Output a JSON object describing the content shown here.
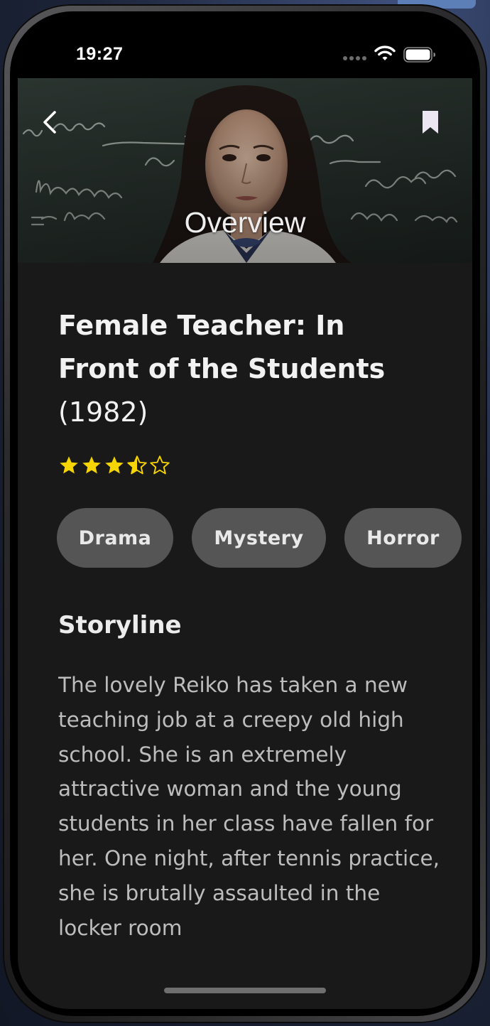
{
  "status_bar": {
    "time": "19:27"
  },
  "header": {
    "title": "Overview",
    "back_icon": "chevron-left-icon",
    "bookmark_icon": "bookmark-icon"
  },
  "movie": {
    "title": "Female Teacher: In Front of the Students",
    "year": "(1982)",
    "rating_stars": 3.5,
    "rating_max": 5,
    "star_color": "#f5d400",
    "genres": [
      {
        "label": "Drama"
      },
      {
        "label": "Mystery"
      },
      {
        "label": "Horror"
      }
    ]
  },
  "storyline": {
    "heading": "Storyline",
    "text": "The lovely Reiko has taken a new teaching job at a creepy old high school.  She is an extremely attractive woman and the young students in her class have fallen for her.  One night, after tennis practice, she is brutally assaulted in the locker room"
  }
}
